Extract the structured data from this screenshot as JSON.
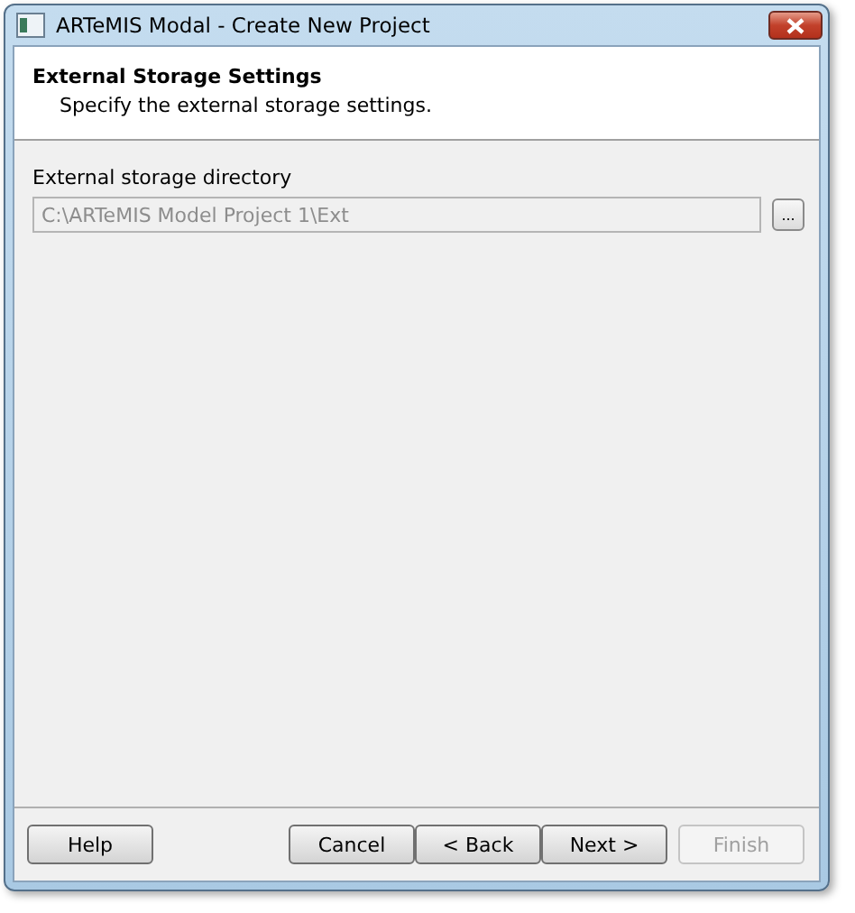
{
  "window": {
    "title": "ARTeMIS Modal - Create New Project"
  },
  "header": {
    "title": "External Storage Settings",
    "subtitle": "Specify the external storage settings."
  },
  "field": {
    "label": "External storage directory",
    "value": "C:\\ARTeMIS Model Project 1\\Ext",
    "disabled": true,
    "browse_label": "..."
  },
  "buttons": [
    {
      "label": "Help",
      "disabled": false,
      "kind": "left"
    },
    {
      "label": "Cancel",
      "disabled": false,
      "kind": "right"
    },
    {
      "label": "< Back",
      "disabled": false,
      "kind": "joined"
    },
    {
      "label": "Next >",
      "disabled": false,
      "kind": "joined"
    },
    {
      "label": "Finish",
      "disabled": true,
      "kind": "right"
    }
  ]
}
